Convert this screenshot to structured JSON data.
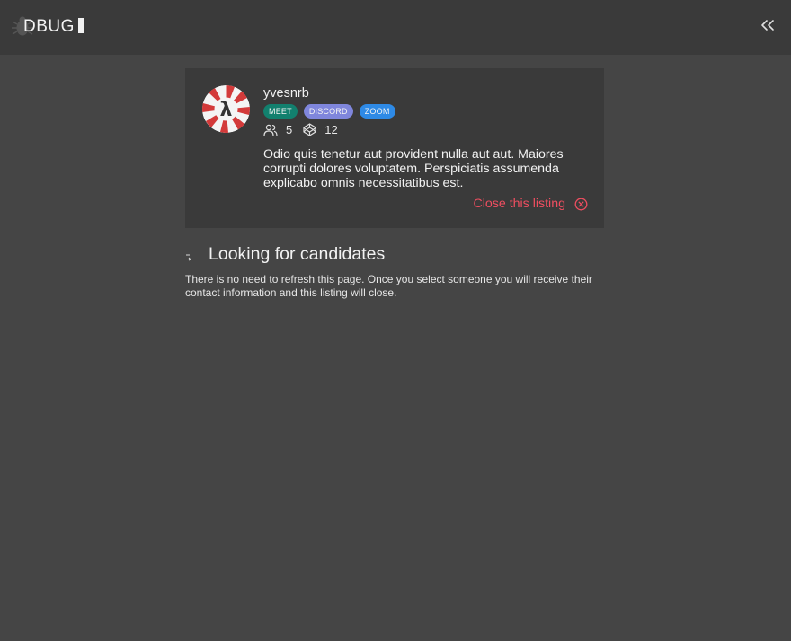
{
  "header": {
    "logo_text": "DBUG"
  },
  "listing": {
    "username": "yvesnrb",
    "tags": [
      {
        "label": "MEET",
        "color": "#12806e"
      },
      {
        "label": "DISCORD",
        "color": "#7f86dc"
      },
      {
        "label": "ZOOM",
        "color": "#2e8ae6"
      }
    ],
    "members_count": "5",
    "code_count": "12",
    "description": "Odio quis tenetur aut provident nulla aut aut. Maiores corrupti dolores voluptatem. Perspiciatis assumenda explicabo omnis necessitatibus est.",
    "close_label": "Close this listing",
    "accent_color": "#ef4e60"
  },
  "status": {
    "title": "Looking for candidates",
    "body": "There is no need to refresh this page. Once you select someone you will receive their contact information and this listing will close."
  },
  "icons": [
    "logo-bug-icon",
    "double-chevron-left-icon",
    "users-icon",
    "codepen-icon",
    "close-circle-icon",
    "spinner-icon"
  ]
}
